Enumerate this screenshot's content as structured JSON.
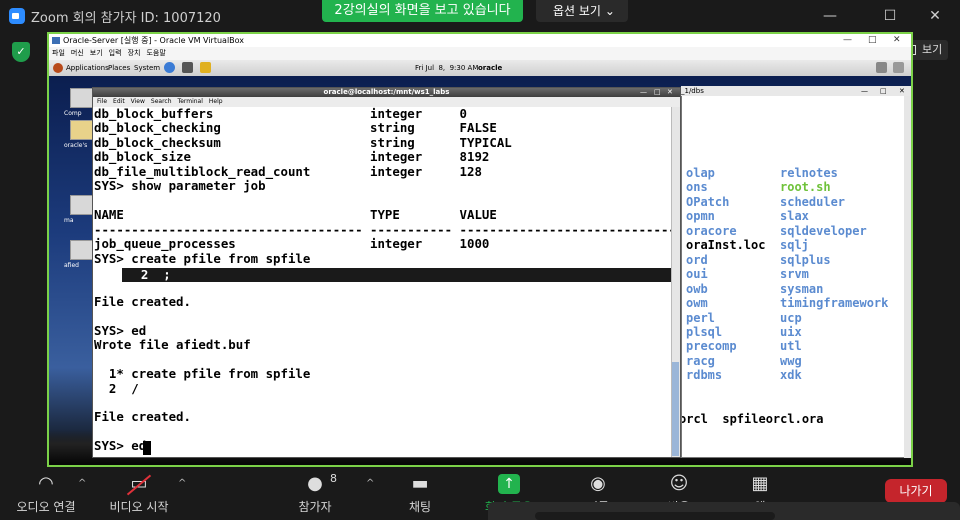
{
  "zoom": {
    "title": "Zoom 회의 참가자 ID: 1007120",
    "share_banner": "2강의실의 화면을 보고 있습니다",
    "view_options": "옵션 보기",
    "view_button": "보기",
    "leave": "나가기",
    "toolbar": [
      {
        "label": "오디오 연결",
        "icon": "headphones-icon"
      },
      {
        "label": "비디오 시작",
        "icon": "video-off-icon"
      },
      {
        "label": "참가자",
        "icon": "participants-icon",
        "count": "8"
      },
      {
        "label": "채팅",
        "icon": "chat-icon"
      },
      {
        "label": "화면 공유",
        "icon": "share-screen-icon"
      },
      {
        "label": "기록",
        "icon": "record-icon"
      },
      {
        "label": "반응",
        "icon": "reaction-icon"
      },
      {
        "label": "앱",
        "icon": "apps-icon"
      }
    ]
  },
  "vbox": {
    "title": "Oracle-Server [실행 중] - Oracle VM VirtualBox",
    "menu": [
      "파일",
      "머신",
      "보기",
      "입력",
      "장치",
      "도움말"
    ]
  },
  "panel": {
    "applications": "Applications",
    "places": "Places",
    "system": "System",
    "datetime": "Fri Jul  8,  9:30 AM",
    "user": "oracle"
  },
  "desktop_icons": [
    "Comp",
    "oracle's",
    "ma",
    "afied"
  ],
  "term1": {
    "title": "oracle@localhost:/mnt/ws1_labs",
    "menu": [
      "File",
      "Edit",
      "View",
      "Search",
      "Terminal",
      "Help"
    ],
    "lines": [
      "db_block_buffers                     integer     0",
      "db_block_checking                    string      FALSE",
      "db_block_checksum                    string      TYPICAL",
      "db_block_size                        integer     8192",
      "db_file_multiblock_read_count        integer     128",
      "SYS> show parameter job",
      "",
      "NAME                                 TYPE        VALUE",
      "------------------------------------ ----------- ------------------------------",
      "job_queue_processes                  integer     1000",
      "SYS> create pfile from spfile",
      "",
      "",
      "File created.",
      "",
      "SYS> ed",
      "Wrote file afiedt.buf",
      "",
      "  1* create pfile from spfile",
      "  2  /",
      "",
      "File created.",
      "",
      "SYS> ed"
    ],
    "highlight_line": "  2  ;"
  },
  "term2": {
    "title": "_1/dbs",
    "col1": [
      "olap",
      "ons",
      "OPatch",
      "opmn",
      "oracore",
      "oraInst.loc",
      "ord",
      "oui",
      "owb",
      "owm",
      "perl",
      "plsql",
      "precomp",
      "racg",
      "rdbms"
    ],
    "col2": [
      "relnotes",
      "root.sh",
      "scheduler",
      "slax",
      "sqldeveloper",
      "sqlj",
      "sqlplus",
      "srvm",
      "sysman",
      "timingframework",
      "ucp",
      "uix",
      "utl",
      "wwg",
      "xdk"
    ],
    "bottom_line": "orcl  spfileorcl.ora",
    "colors": {
      "dir": "#5b8bd0",
      "exec": "#6fc23a",
      "file": "#000000"
    }
  }
}
